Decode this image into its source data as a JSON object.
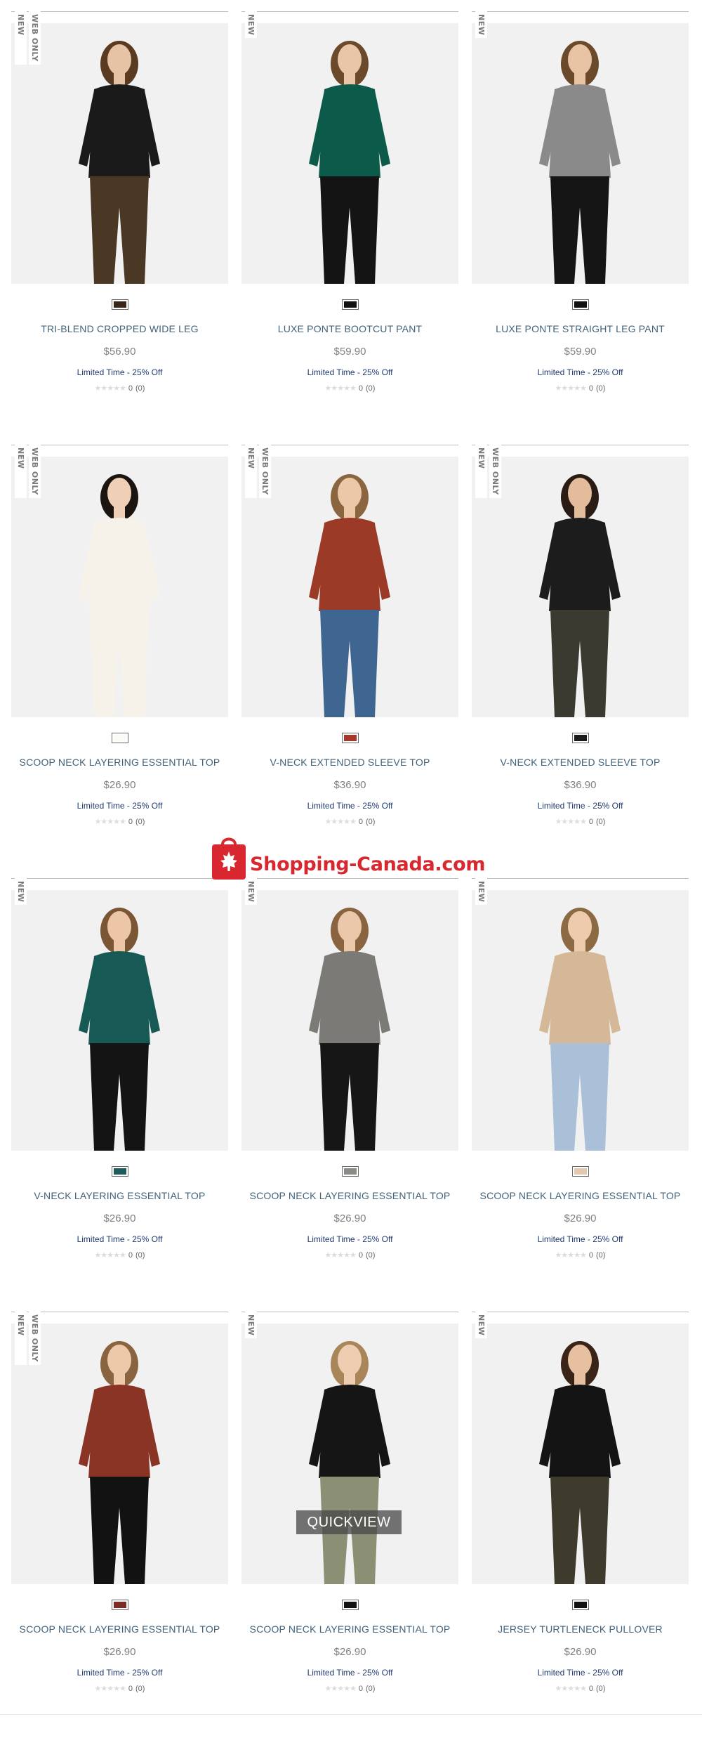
{
  "watermark": {
    "text": "Shopping-Canada.com"
  },
  "badges": {
    "new": "NEW",
    "web_only": "WEB ONLY"
  },
  "quickview_label": "QUICKVIEW",
  "products": [
    {
      "name": "TRI-BLEND CROPPED WIDE LEG",
      "price": "$56.90",
      "promo": "Limited Time - 25% Off",
      "rating": "0",
      "reviews": "(0)",
      "swatch": "#3a2618",
      "web_only": true,
      "top": "#1a1a1a",
      "bottom": "#4a3824",
      "skin": "#e7c3a5",
      "hair": "#5a3b22"
    },
    {
      "name": "LUXE PONTE BOOTCUT PANT",
      "price": "$59.90",
      "promo": "Limited Time - 25% Off",
      "rating": "0",
      "reviews": "(0)",
      "swatch": "#111111",
      "web_only": false,
      "top": "#0c5a4a",
      "bottom": "#141414",
      "skin": "#e9c6a8",
      "hair": "#6b4a2b"
    },
    {
      "name": "LUXE PONTE STRAIGHT LEG PANT",
      "price": "$59.90",
      "promo": "Limited Time - 25% Off",
      "rating": "0",
      "reviews": "(0)",
      "swatch": "#111111",
      "web_only": false,
      "top": "#8a8a8a",
      "bottom": "#151515",
      "skin": "#e8c4a4",
      "hair": "#6a4a2a"
    },
    {
      "name": "SCOOP NECK LAYERING ESSENTIAL TOP",
      "price": "$26.90",
      "promo": "Limited Time - 25% Off",
      "rating": "0",
      "reviews": "(0)",
      "swatch": "#fbfaf5",
      "web_only": true,
      "top": "#f6f2ea",
      "bottom": "#f6f2ea",
      "skin": "#efd0b6",
      "hair": "#1c1410"
    },
    {
      "name": "V-NECK EXTENDED SLEEVE TOP",
      "price": "$36.90",
      "promo": "Limited Time - 25% Off",
      "rating": "0",
      "reviews": "(0)",
      "swatch": "#a3382b",
      "web_only": true,
      "top": "#9c3a28",
      "bottom": "#3f6690",
      "skin": "#ecc8a8",
      "hair": "#8a6540"
    },
    {
      "name": "V-NECK EXTENDED SLEEVE TOP",
      "price": "$36.90",
      "promo": "Limited Time - 25% Off",
      "rating": "0",
      "reviews": "(0)",
      "swatch": "#1a1a1a",
      "web_only": true,
      "top": "#1c1c1c",
      "bottom": "#3b3a30",
      "skin": "#e3bc9c",
      "hair": "#2a1c14"
    },
    {
      "name": "V-NECK LAYERING ESSENTIAL TOP",
      "price": "$26.90",
      "promo": "Limited Time - 25% Off",
      "rating": "0",
      "reviews": "(0)",
      "swatch": "#1d5c5c",
      "web_only": false,
      "top": "#175a55",
      "bottom": "#141414",
      "skin": "#ecc6a6",
      "hair": "#7a5634"
    },
    {
      "name": "SCOOP NECK LAYERING ESSENTIAL TOP",
      "price": "$26.90",
      "promo": "Limited Time - 25% Off",
      "rating": "0",
      "reviews": "(0)",
      "swatch": "#8a8a86",
      "web_only": false,
      "top": "#7c7a76",
      "bottom": "#161616",
      "skin": "#ecc8aa",
      "hair": "#8a6440"
    },
    {
      "name": "SCOOP NECK LAYERING ESSENTIAL TOP",
      "price": "$26.90",
      "promo": "Limited Time - 25% Off",
      "rating": "0",
      "reviews": "(0)",
      "swatch": "#e2c8ae",
      "web_only": false,
      "top": "#d5b898",
      "bottom": "#a9c0d8",
      "skin": "#eecbad",
      "hair": "#8c6a44"
    },
    {
      "name": "SCOOP NECK LAYERING ESSENTIAL TOP",
      "price": "$26.90",
      "promo": "Limited Time - 25% Off",
      "rating": "0",
      "reviews": "(0)",
      "swatch": "#7e2b25",
      "web_only": true,
      "top": "#8a3426",
      "bottom": "#121212",
      "skin": "#edc9aa",
      "hair": "#8a6440"
    },
    {
      "name": "SCOOP NECK LAYERING ESSENTIAL TOP",
      "price": "$26.90",
      "promo": "Limited Time - 25% Off",
      "rating": "0",
      "reviews": "(0)",
      "swatch": "#121212",
      "web_only": false,
      "top": "#151515",
      "bottom": "#8b8f74",
      "skin": "#eecdb0",
      "hair": "#a8865a",
      "quickview": true
    },
    {
      "name": "JERSEY TURTLENECK PULLOVER",
      "price": "$26.90",
      "promo": "Limited Time - 25% Off",
      "rating": "0",
      "reviews": "(0)",
      "swatch": "#121212",
      "web_only": false,
      "top": "#141414",
      "bottom": "#3e3a2c",
      "skin": "#e6c0a0",
      "hair": "#3a2418"
    }
  ]
}
